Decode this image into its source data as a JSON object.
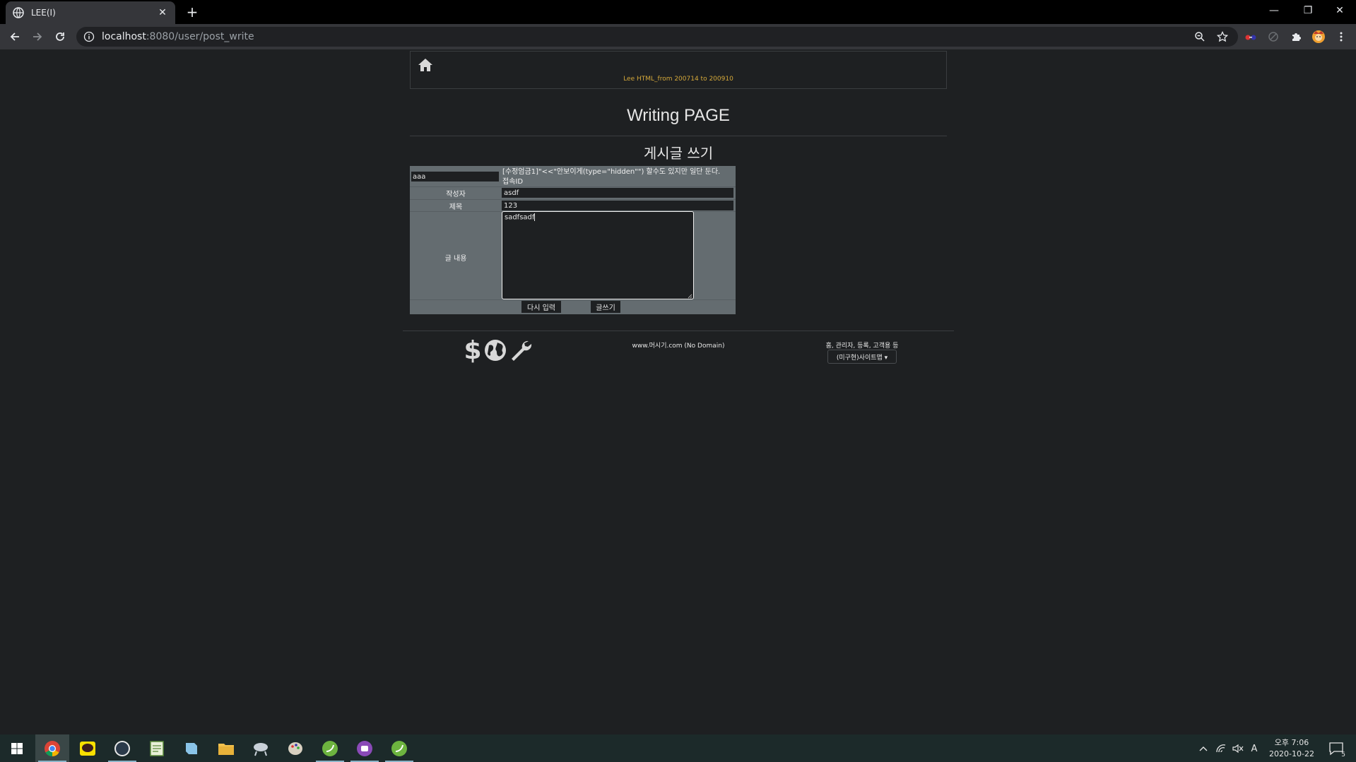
{
  "browser": {
    "tab_title": "LEE(I)",
    "url_host": "localhost",
    "url_path": ":8080/user/post_write",
    "tab_close": "✕",
    "new_tab": "+",
    "minimize": "—",
    "restore": "❐",
    "close": "✕"
  },
  "header": {
    "subtitle": "Lee HTML_from 200714 to 200910"
  },
  "page": {
    "title": "Writing PAGE",
    "subtitle": "게시글 쓰기"
  },
  "form": {
    "id_value": "aaa",
    "note_line1": "[수정엄금1]\"<<\"안보이게(type=\"hidden\"\") 할수도 있지만 일단 둔다.",
    "note_line2": "접속ID",
    "writer_label": "작성자",
    "writer_value": "asdf",
    "title_label": "제목",
    "title_value": "123",
    "content_label": "글 내용",
    "content_value": "sadfsadf",
    "reset_label": "다시 입력",
    "submit_label": "글쓰기"
  },
  "footer": {
    "center_text": "www.머시기.com (No Domain)",
    "right_text": "홈, 관리자, 등록, 고객용 등",
    "dropdown_label": "(미구현)사이트맵 ▾"
  },
  "taskbar": {
    "clock_time": "오후 7:06",
    "clock_date": "2020-10-22",
    "ime": "A",
    "notif_count": "5"
  },
  "colors": {
    "page_bg": "#1e2022",
    "form_bg": "#646c70",
    "accent_gold": "#d4a83a"
  }
}
